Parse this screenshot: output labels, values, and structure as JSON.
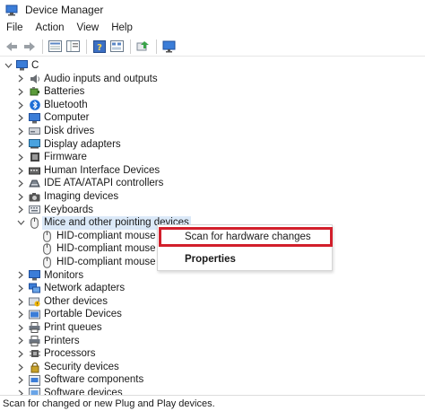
{
  "window": {
    "title": "Device Manager"
  },
  "menu": {
    "items": [
      "File",
      "Action",
      "View",
      "Help"
    ]
  },
  "toolbar": {
    "icons": [
      "back-arrow-icon",
      "forward-arrow-icon",
      "properties-sheet-icon",
      "show-hidden-icon",
      "help-icon",
      "device-sheet-icon",
      "update-driver-icon",
      "monitor-scan-icon"
    ]
  },
  "tree": {
    "root": "C",
    "items": [
      {
        "label": "Audio inputs and outputs",
        "icon": "speaker-icon",
        "expanded": false
      },
      {
        "label": "Batteries",
        "icon": "battery-icon",
        "expanded": false
      },
      {
        "label": "Bluetooth",
        "icon": "bluetooth-icon",
        "expanded": false
      },
      {
        "label": "Computer",
        "icon": "computer-icon",
        "expanded": false
      },
      {
        "label": "Disk drives",
        "icon": "disk-drive-icon",
        "expanded": false
      },
      {
        "label": "Display adapters",
        "icon": "display-adapter-icon",
        "expanded": false
      },
      {
        "label": "Firmware",
        "icon": "firmware-icon",
        "expanded": false
      },
      {
        "label": "Human Interface Devices",
        "icon": "hid-icon",
        "expanded": false
      },
      {
        "label": "IDE ATA/ATAPI controllers",
        "icon": "ide-controller-icon",
        "expanded": false
      },
      {
        "label": "Imaging devices",
        "icon": "camera-icon",
        "expanded": false
      },
      {
        "label": "Keyboards",
        "icon": "keyboard-icon",
        "expanded": false
      },
      {
        "label": "Mice and other pointing devices",
        "icon": "mouse-icon",
        "expanded": true,
        "selected": true
      },
      {
        "label": "HID-compliant mouse",
        "icon": "mouse-icon",
        "child": true
      },
      {
        "label": "HID-compliant mouse",
        "icon": "mouse-icon",
        "child": true
      },
      {
        "label": "HID-compliant mouse",
        "icon": "mouse-icon",
        "child": true
      },
      {
        "label": "Monitors",
        "icon": "monitor-icon",
        "expanded": false
      },
      {
        "label": "Network adapters",
        "icon": "network-adapter-icon",
        "expanded": false
      },
      {
        "label": "Other devices",
        "icon": "other-device-icon",
        "expanded": false
      },
      {
        "label": "Portable Devices",
        "icon": "portable-device-icon",
        "expanded": false
      },
      {
        "label": "Print queues",
        "icon": "printer-icon",
        "expanded": false
      },
      {
        "label": "Printers",
        "icon": "printer-icon",
        "expanded": false
      },
      {
        "label": "Processors",
        "icon": "processor-icon",
        "expanded": false
      },
      {
        "label": "Security devices",
        "icon": "security-device-icon",
        "expanded": false
      },
      {
        "label": "Software components",
        "icon": "software-component-icon",
        "expanded": false
      },
      {
        "label": "Software devices",
        "icon": "software-device-icon",
        "expanded": false
      }
    ]
  },
  "context_menu": {
    "scan_label": "Scan for hardware changes",
    "properties_label": "Properties",
    "highlight_color": "#d21f2b"
  },
  "status": {
    "text": "Scan for changed or new Plug and Play devices."
  }
}
